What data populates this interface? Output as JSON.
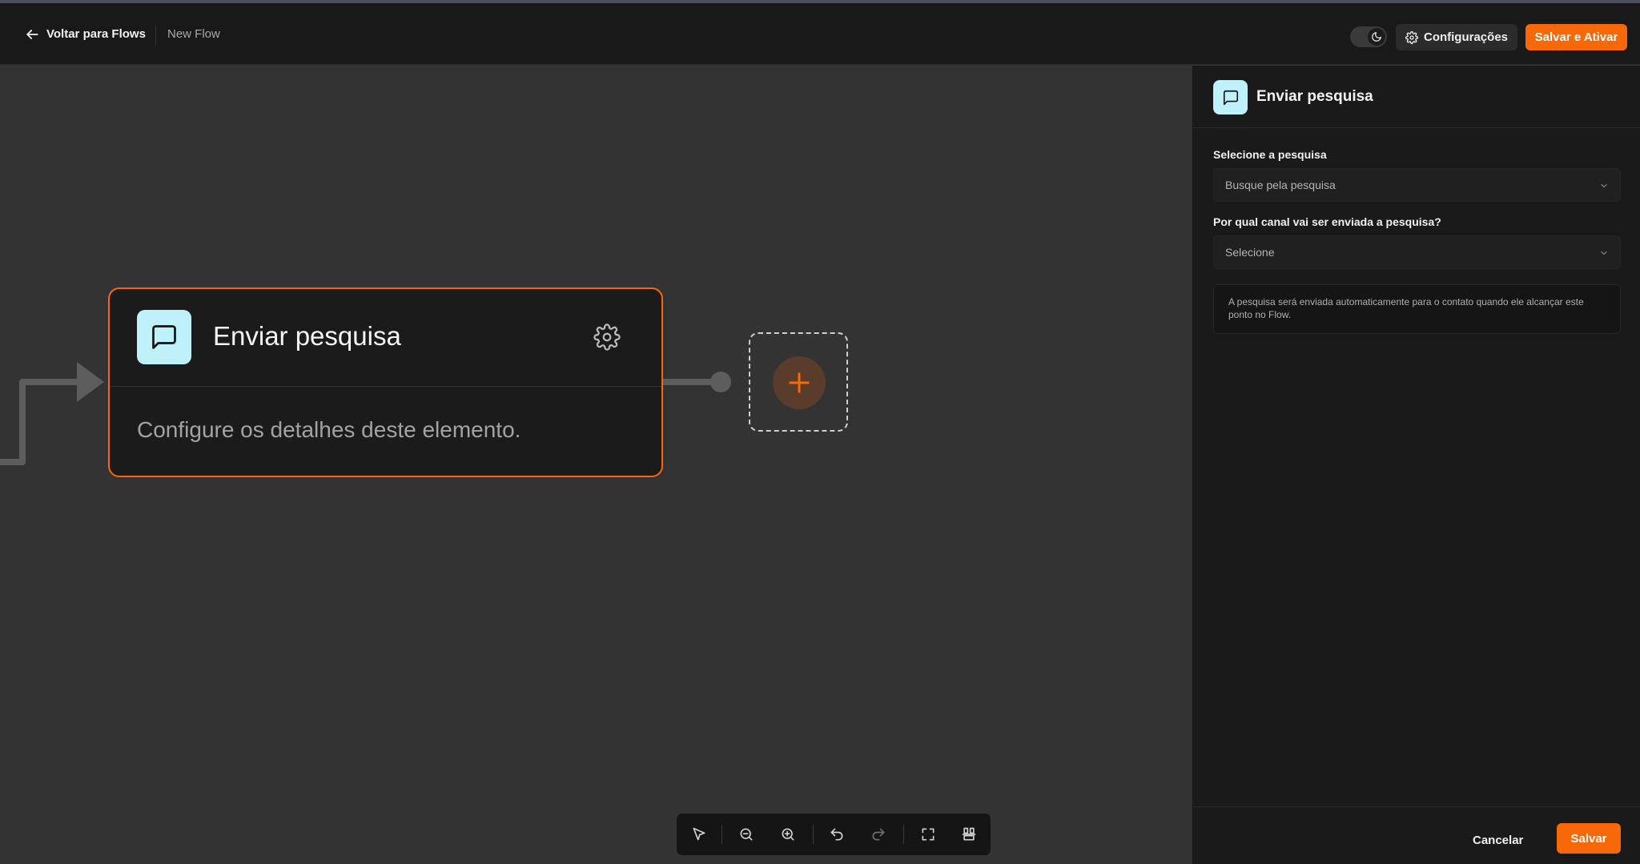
{
  "header": {
    "back_label": "Voltar para Flows",
    "flow_name": "New Flow",
    "config_label": "Configurações",
    "save_activate_label": "Salvar e Ativar"
  },
  "canvas": {
    "node": {
      "title": "Enviar pesquisa",
      "description": "Configure os detalhes deste elemento."
    }
  },
  "toolbar": {
    "tools": [
      "select-pointer",
      "zoom-out",
      "zoom-in",
      "undo",
      "redo",
      "fit-view",
      "auto-layout"
    ]
  },
  "panel": {
    "title": "Enviar pesquisa",
    "survey_label": "Selecione a pesquisa",
    "survey_placeholder": "Busque pela pesquisa",
    "channel_label": "Por qual canal vai ser enviada a pesquisa?",
    "channel_placeholder": "Selecione",
    "info_text": "A pesquisa será enviada automaticamente para o contato quando ele alcançar este ponto no Flow.",
    "cancel_label": "Cancelar",
    "save_label": "Salvar"
  },
  "colors": {
    "accent": "#f76808",
    "icon_bg": "#bff1fb",
    "canvas_bg": "#333333",
    "panel_bg": "#1a1a1a"
  }
}
